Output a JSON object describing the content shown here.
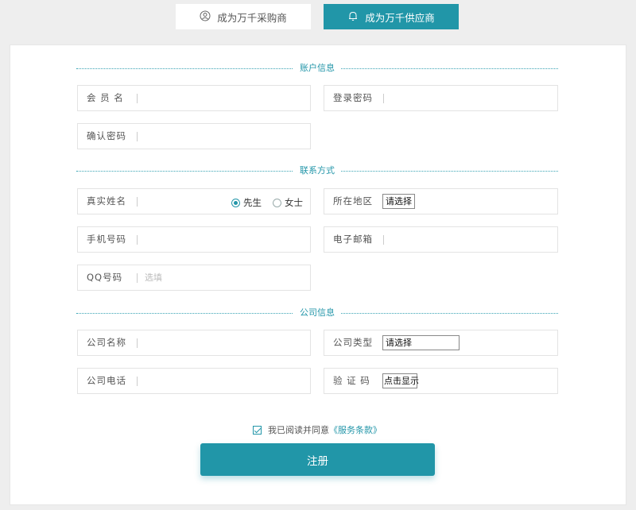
{
  "tabs": {
    "buyer": {
      "label": "成为万千采购商",
      "icon": "user-circle-icon"
    },
    "supplier": {
      "label": "成为万千供应商",
      "icon": "bell-icon",
      "active": true
    }
  },
  "sections": {
    "account": "账户信息",
    "contact": "联系方式",
    "company": "公司信息"
  },
  "fields": {
    "member_name": {
      "label": "会 员 名"
    },
    "password": {
      "label": "登录密码"
    },
    "confirm_password": {
      "label": "确认密码"
    },
    "real_name": {
      "label": "真实姓名"
    },
    "gender": {
      "options": [
        "先生",
        "女士"
      ],
      "selected": "先生"
    },
    "region": {
      "label": "所在地区",
      "select": "请选择"
    },
    "mobile": {
      "label": "手机号码"
    },
    "email": {
      "label": "电子邮箱"
    },
    "qq": {
      "label": "QQ号码",
      "placeholder": "选填"
    },
    "company_name": {
      "label": "公司名称"
    },
    "company_type": {
      "label": "公司类型",
      "select": "请选择"
    },
    "company_phone": {
      "label": "公司电话"
    },
    "captcha": {
      "label": "验 证 码",
      "button": "点击显示"
    }
  },
  "agreement": {
    "text": "我已阅读并同意",
    "link": "《服务条款》",
    "checked": true
  },
  "register_button": "注册",
  "colors": {
    "accent": "#2196a8",
    "background": "#eeeeee",
    "card": "#ffffff"
  }
}
